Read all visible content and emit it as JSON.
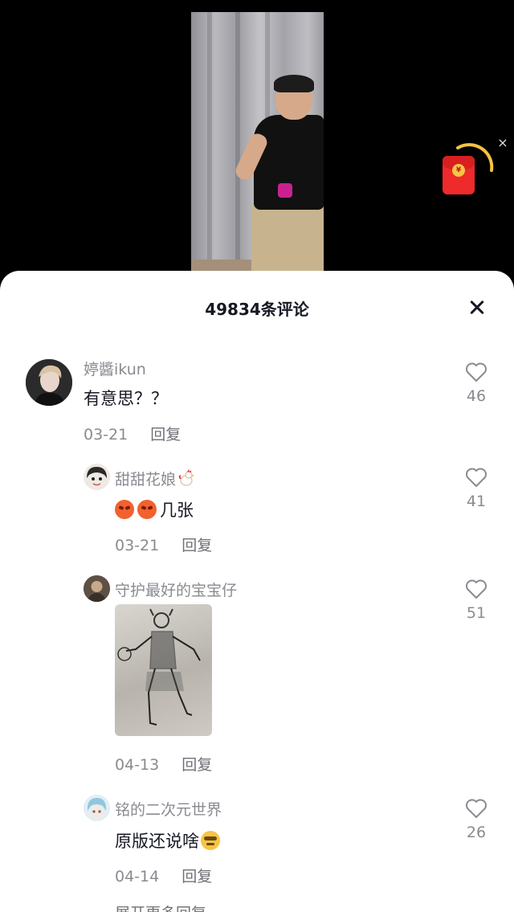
{
  "comments_header": {
    "title": "49834条评论"
  },
  "redpacket": {
    "coin_glyph": "¥",
    "close_glyph": "×"
  },
  "comments": [
    {
      "username": "婷醬ikun",
      "text": "有意思？？",
      "date": "03-21",
      "reply_label": "回复",
      "likes": "46"
    },
    {
      "username": "甜甜花娘",
      "text": "几张",
      "date": "03-21",
      "reply_label": "回复",
      "likes": "41"
    },
    {
      "username": "守护最好的宝宝仔",
      "date": "04-13",
      "reply_label": "回复",
      "likes": "51"
    },
    {
      "username": "铭的二次元世界",
      "text": "原版还说啥",
      "date": "04-14",
      "reply_label": "回复",
      "likes": "26"
    }
  ],
  "more_replies_label": "展开更多回复",
  "colors": {
    "accent_red": "#ef2a2a",
    "text_primary": "#161823",
    "text_secondary": "#8a8b91"
  },
  "icons": [
    "heart-icon",
    "close-icon",
    "red-packet-icon",
    "angry-face-emoji",
    "smug-face-emoji",
    "rooster-emoji"
  ]
}
